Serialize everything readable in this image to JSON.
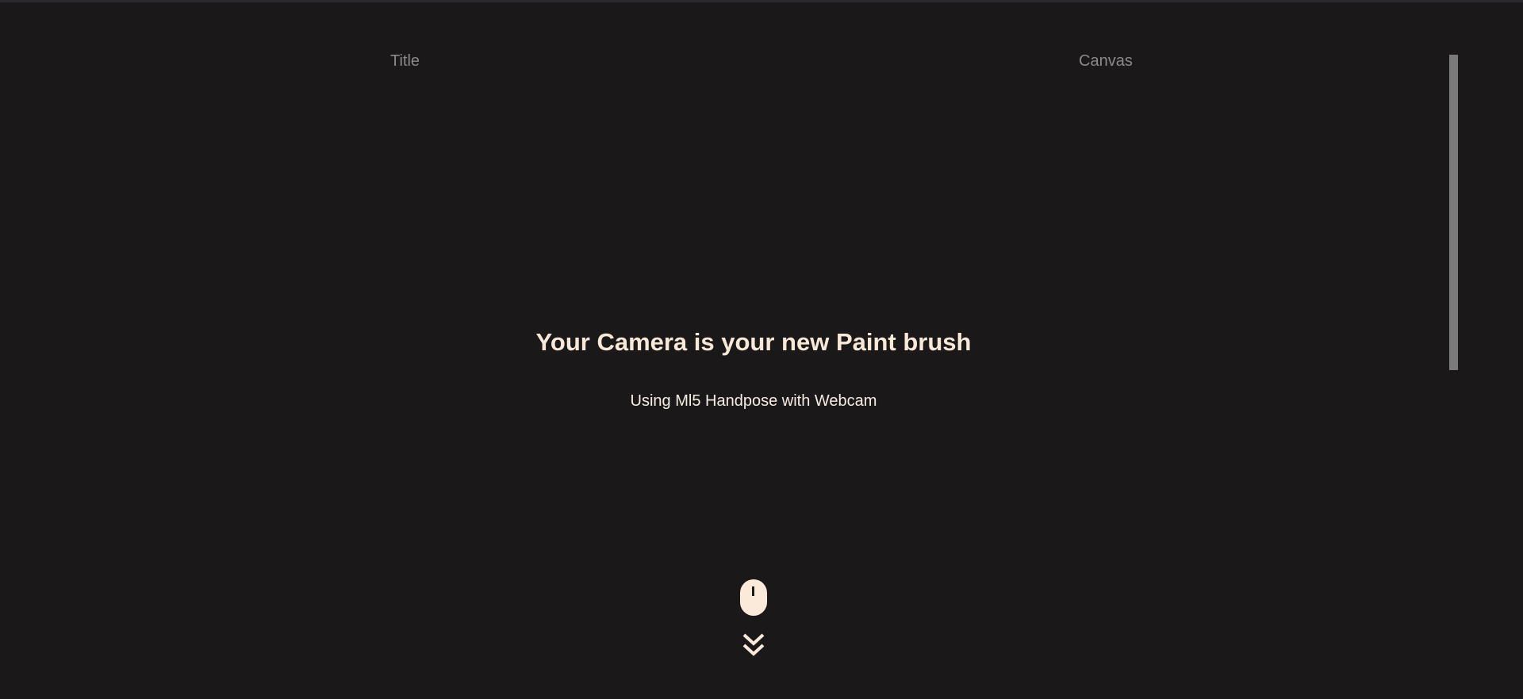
{
  "nav": {
    "title_label": "Title",
    "canvas_label": "Canvas"
  },
  "hero": {
    "title": "Your Camera is your new Paint brush",
    "subtitle": "Using Ml5 Handpose with Webcam"
  },
  "icons": {
    "mouse": "mouse-icon",
    "scroll_down": "double-chevron-down-icon"
  },
  "colors": {
    "background": "#1a1819",
    "accent": "#f7e8d8",
    "nav_text": "#8b8a8a"
  }
}
